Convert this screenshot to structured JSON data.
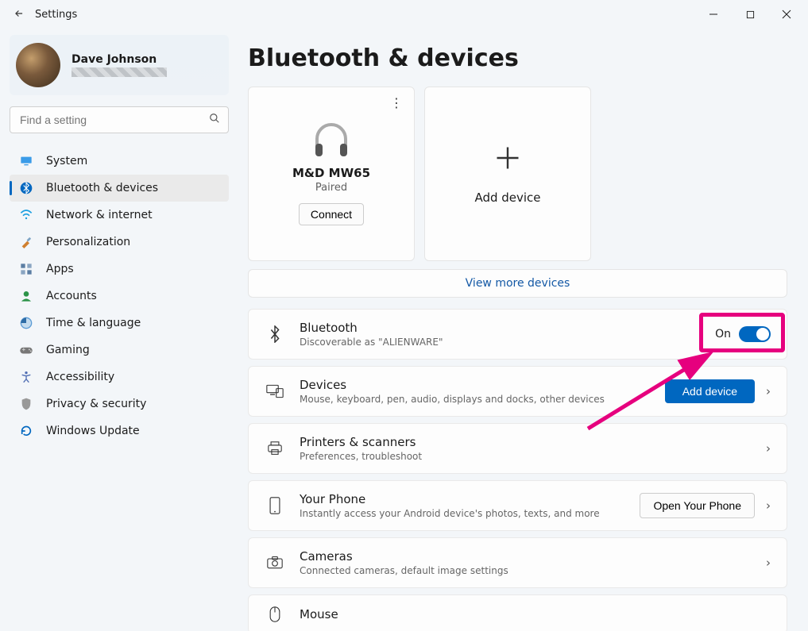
{
  "window": {
    "title": "Settings"
  },
  "user": {
    "name": "Dave Johnson"
  },
  "search": {
    "placeholder": "Find a setting"
  },
  "nav": {
    "items": [
      {
        "label": "System",
        "icon": "system",
        "selected": false
      },
      {
        "label": "Bluetooth & devices",
        "icon": "bluetooth",
        "selected": true
      },
      {
        "label": "Network & internet",
        "icon": "wifi",
        "selected": false
      },
      {
        "label": "Personalization",
        "icon": "brush",
        "selected": false
      },
      {
        "label": "Apps",
        "icon": "apps",
        "selected": false
      },
      {
        "label": "Accounts",
        "icon": "person",
        "selected": false
      },
      {
        "label": "Time & language",
        "icon": "clock",
        "selected": false
      },
      {
        "label": "Gaming",
        "icon": "game",
        "selected": false
      },
      {
        "label": "Accessibility",
        "icon": "a11y",
        "selected": false
      },
      {
        "label": "Privacy & security",
        "icon": "shield",
        "selected": false
      },
      {
        "label": "Windows Update",
        "icon": "update",
        "selected": false
      }
    ]
  },
  "page": {
    "title": "Bluetooth & devices"
  },
  "device_card": {
    "name": "M&D MW65",
    "status": "Paired",
    "connect_label": "Connect"
  },
  "add_card": {
    "label": "Add device"
  },
  "view_more": "View more devices",
  "bluetooth_row": {
    "title": "Bluetooth",
    "subtitle": "Discoverable as \"ALIENWARE\"",
    "toggle_label": "On",
    "toggle_on": true
  },
  "devices_row": {
    "title": "Devices",
    "subtitle": "Mouse, keyboard, pen, audio, displays and docks, other devices",
    "button_label": "Add device"
  },
  "printers_row": {
    "title": "Printers & scanners",
    "subtitle": "Preferences, troubleshoot"
  },
  "phone_row": {
    "title": "Your Phone",
    "subtitle": "Instantly access your Android device's photos, texts, and more",
    "button_label": "Open Your Phone"
  },
  "cameras_row": {
    "title": "Cameras",
    "subtitle": "Connected cameras, default image settings"
  },
  "mouse_row": {
    "title": "Mouse"
  }
}
